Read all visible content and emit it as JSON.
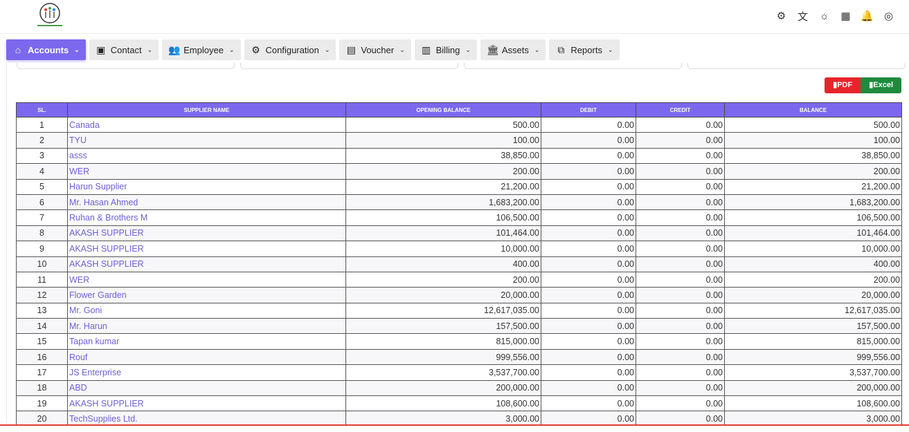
{
  "header": {
    "icons": [
      {
        "name": "settings-icon",
        "glyph": "⚙"
      },
      {
        "name": "translate-icon",
        "glyph": "文"
      },
      {
        "name": "theme-toggle-icon",
        "glyph": "☼"
      },
      {
        "name": "apps-grid-icon",
        "glyph": "▦"
      },
      {
        "name": "notification-bell-icon",
        "glyph": "🔔"
      },
      {
        "name": "user-avatar-icon",
        "glyph": "◎"
      }
    ]
  },
  "nav": [
    {
      "label": "Accounts",
      "icon": "home-icon",
      "glyph": "⌂",
      "active": true
    },
    {
      "label": "Contact",
      "icon": "contact-card-icon",
      "glyph": "▣",
      "active": false
    },
    {
      "label": "Employee",
      "icon": "users-icon",
      "glyph": "👥",
      "active": false
    },
    {
      "label": "Configuration",
      "icon": "gear-icon",
      "glyph": "⚙",
      "active": false
    },
    {
      "label": "Voucher",
      "icon": "receipt-icon",
      "glyph": "▤",
      "active": false
    },
    {
      "label": "Billing",
      "icon": "invoice-icon",
      "glyph": "▥",
      "active": false
    },
    {
      "label": "Assets",
      "icon": "bank-icon",
      "glyph": "🏛",
      "active": false
    },
    {
      "label": "Reports",
      "icon": "copy-icon",
      "glyph": "⧉",
      "active": false
    }
  ],
  "export": {
    "pdf_label": "PDF",
    "excel_label": "Excel"
  },
  "table": {
    "headers": [
      "SL.",
      "SUPPLIER NAME",
      "OPENING BALANCE",
      "DEBIT",
      "CREDIT",
      "BALANCE"
    ],
    "rows": [
      [
        "1",
        "Canada",
        "500.00",
        "0.00",
        "0.00",
        "500.00"
      ],
      [
        "2",
        "TYU",
        "100.00",
        "0.00",
        "0.00",
        "100.00"
      ],
      [
        "3",
        "asss",
        "38,850.00",
        "0.00",
        "0.00",
        "38,850.00"
      ],
      [
        "4",
        "WER",
        "200.00",
        "0.00",
        "0.00",
        "200.00"
      ],
      [
        "5",
        "Harun Supplier",
        "21,200.00",
        "0.00",
        "0.00",
        "21,200.00"
      ],
      [
        "6",
        "Mr. Hasan Ahmed",
        "1,683,200.00",
        "0.00",
        "0.00",
        "1,683,200.00"
      ],
      [
        "7",
        "Ruhan & Brothers M",
        "106,500.00",
        "0.00",
        "0.00",
        "106,500.00"
      ],
      [
        "8",
        "AKASH SUPPLIER",
        "101,464.00",
        "0.00",
        "0.00",
        "101,464.00"
      ],
      [
        "9",
        "AKASH SUPPLIER",
        "10,000.00",
        "0.00",
        "0.00",
        "10,000.00"
      ],
      [
        "10",
        "AKASH SUPPLIER",
        "400.00",
        "0.00",
        "0.00",
        "400.00"
      ],
      [
        "11",
        "WER",
        "200.00",
        "0.00",
        "0.00",
        "200.00"
      ],
      [
        "12",
        "Flower Garden",
        "20,000.00",
        "0.00",
        "0.00",
        "20,000.00"
      ],
      [
        "13",
        "Mr. Goni",
        "12,617,035.00",
        "0.00",
        "0.00",
        "12,617,035.00"
      ],
      [
        "14",
        "Mr. Harun",
        "157,500.00",
        "0.00",
        "0.00",
        "157,500.00"
      ],
      [
        "15",
        "Tapan kumar",
        "815,000.00",
        "0.00",
        "0.00",
        "815,000.00"
      ],
      [
        "16",
        "Rouf",
        "999,556.00",
        "0.00",
        "0.00",
        "999,556.00"
      ],
      [
        "17",
        "JS Enterprise",
        "3,537,700.00",
        "0.00",
        "0.00",
        "3,537,700.00"
      ],
      [
        "18",
        "ABD",
        "200,000.00",
        "0.00",
        "0.00",
        "200,000.00"
      ],
      [
        "19",
        "AKASH SUPPLIER",
        "108,600.00",
        "0.00",
        "0.00",
        "108,600.00"
      ],
      [
        "20",
        "TechSupplies Ltd.",
        "3,000.00",
        "0.00",
        "0.00",
        "3,000.00"
      ]
    ]
  },
  "colors": {
    "accent": "#7b68ee",
    "pdf": "#e8242b",
    "excel": "#1f8a3c"
  }
}
